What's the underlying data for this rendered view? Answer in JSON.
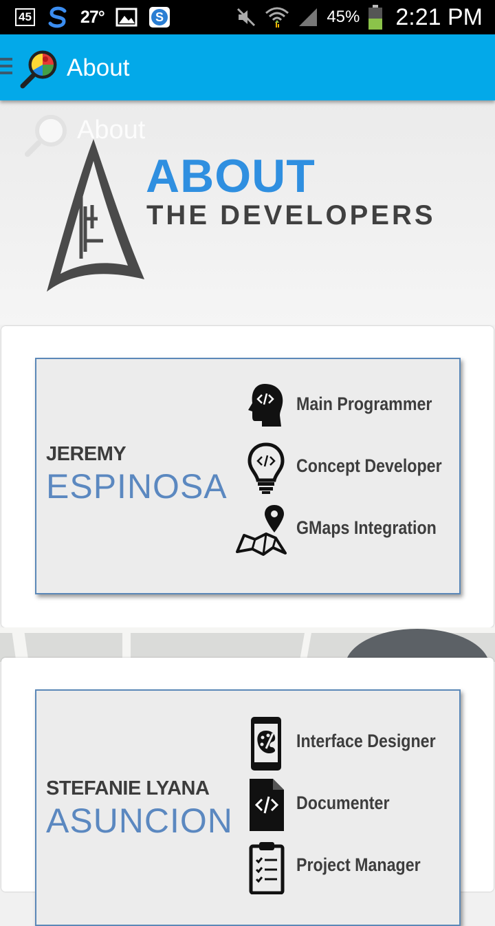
{
  "status_bar": {
    "notification_badge": "45",
    "temperature": "27°",
    "battery_percent": "45%",
    "time": "2:21 PM",
    "icons": [
      "s-app-icon",
      "image-icon",
      "s-badge-icon",
      "mute-icon",
      "wifi-icon",
      "signal-icon",
      "battery-icon"
    ]
  },
  "action_bar": {
    "title": "About",
    "color": "#03a9e9"
  },
  "header": {
    "ghost_title": "About",
    "heading": "ABOUT",
    "subheading": "THE DEVELOPERS",
    "heading_color": "#2f8fe0"
  },
  "developers": [
    {
      "first_name": "JEREMY",
      "last_name": "ESPINOSA",
      "roles": [
        {
          "label": "Main Programmer",
          "icon": "head-code-icon"
        },
        {
          "label": "Concept Developer",
          "icon": "lightbulb-code-icon"
        },
        {
          "label": "GMaps Integration",
          "icon": "map-pin-icon"
        }
      ]
    },
    {
      "first_name": "STEFANIE LYANA",
      "last_name": "ASUNCION",
      "roles": [
        {
          "label": "Interface Designer",
          "icon": "phone-palette-icon"
        },
        {
          "label": "Documenter",
          "icon": "code-document-icon"
        },
        {
          "label": "Project Manager",
          "icon": "clipboard-checklist-icon"
        }
      ]
    }
  ]
}
